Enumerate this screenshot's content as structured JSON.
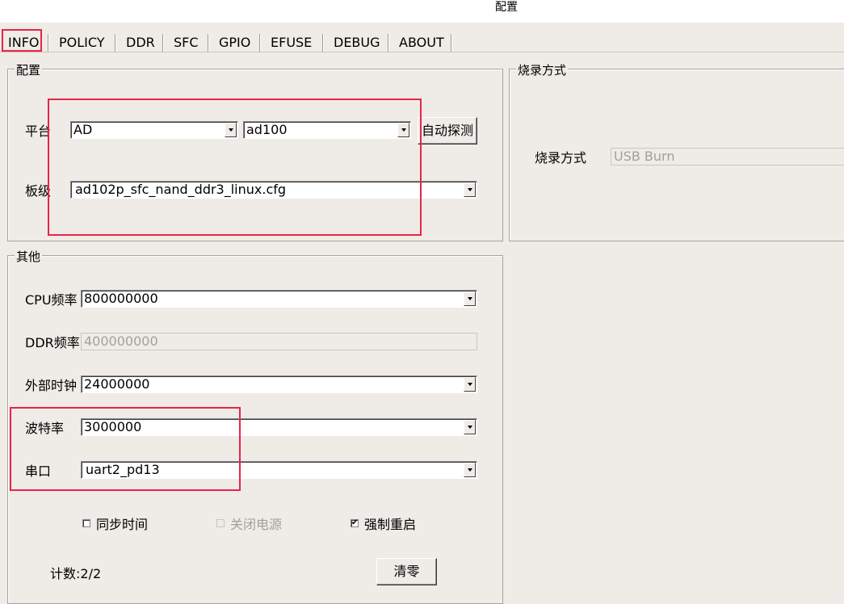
{
  "window": {
    "title": "配置"
  },
  "tabs": [
    {
      "label": "INFO",
      "active": true
    },
    {
      "label": "POLICY"
    },
    {
      "label": "DDR"
    },
    {
      "label": "SFC"
    },
    {
      "label": "GPIO"
    },
    {
      "label": "EFUSE"
    },
    {
      "label": "DEBUG"
    },
    {
      "label": "ABOUT"
    }
  ],
  "config": {
    "legend": "配置",
    "platform_label": "平台",
    "platform_value": "AD",
    "chip_value": "ad100",
    "auto_detect_label": "自动探测",
    "board_label": "板级",
    "board_value": "ad102p_sfc_nand_ddr3_linux.cfg"
  },
  "burn": {
    "legend": "烧录方式",
    "method_label": "烧录方式",
    "method_value": "USB Burn"
  },
  "other": {
    "legend": "其他",
    "cpu_freq_label": "CPU频率",
    "cpu_freq_value": "800000000",
    "ddr_freq_label": "DDR频率",
    "ddr_freq_value": "400000000",
    "ext_clock_label": "外部时钟",
    "ext_clock_value": "24000000",
    "baud_label": "波特率",
    "baud_value": "3000000",
    "serial_label": "串口",
    "serial_value": "uart2_pd13",
    "sync_time_label": "同步时间",
    "sync_time_checked": false,
    "power_off_label": "关闭电源",
    "power_off_checked": false,
    "force_reboot_label": "强制重启",
    "force_reboot_checked": true,
    "count_label": "计数:2/2",
    "clear_label": "清零"
  }
}
